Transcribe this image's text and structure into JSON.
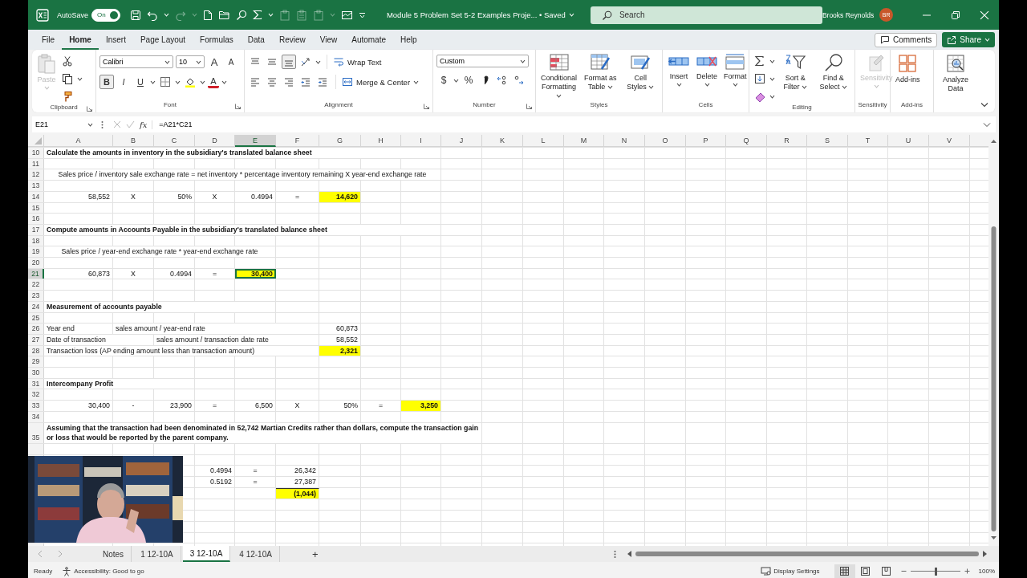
{
  "title_bar": {
    "autosave_label": "AutoSave",
    "autosave_toggle": {
      "label": "On",
      "on": true
    },
    "document_title": "Module 5 Problem Set 5-2 Examples Proje... • Saved",
    "search": {
      "placeholder": "Search"
    },
    "user_name": "Brooks Reynolds",
    "avatar_initials": "BR"
  },
  "menu_tabs": [
    {
      "label": "File",
      "selected": false
    },
    {
      "label": "Home",
      "selected": true
    },
    {
      "label": "Insert",
      "selected": false
    },
    {
      "label": "Page Layout",
      "selected": false
    },
    {
      "label": "Formulas",
      "selected": false
    },
    {
      "label": "Data",
      "selected": false
    },
    {
      "label": "Review",
      "selected": false
    },
    {
      "label": "View",
      "selected": false
    },
    {
      "label": "Automate",
      "selected": false
    },
    {
      "label": "Help",
      "selected": false
    }
  ],
  "comments_button": "Comments",
  "share_button": "Share",
  "ribbon": {
    "clipboard": {
      "paste": {
        "label": "Paste",
        "disabled": true
      },
      "group_label": "Clipboard"
    },
    "font": {
      "font_name": "Calibri",
      "font_size": "10",
      "grow_font": "A",
      "shrink_font": "A",
      "bold": {
        "label": "B",
        "on": true
      },
      "italic": {
        "label": "I",
        "on": false
      },
      "underline": {
        "label": "U",
        "on": false
      },
      "font_color": "A",
      "group_label": "Font"
    },
    "alignment": {
      "wrap_text": "Wrap Text",
      "merge_center": "Merge & Center",
      "group_label": "Alignment"
    },
    "number": {
      "format": "Custom",
      "currency": "$",
      "percent": "%",
      "group_label": "Number"
    },
    "styles": {
      "buttons": [
        "Conditional Formatting",
        "Format as Table",
        "Cell Styles"
      ],
      "group_label": "Styles"
    },
    "cells": {
      "buttons": [
        "Insert",
        "Delete",
        "Format"
      ],
      "group_label": "Cells"
    },
    "editing": {
      "buttons": [
        "Sort & Filter",
        "Find & Select"
      ],
      "group_label": "Editing"
    },
    "sensitivity": {
      "button": {
        "label": "Sensitivity",
        "disabled": true
      },
      "group_label": "Sensitivity"
    },
    "addins": {
      "button": "Add-ins",
      "group_label": "Add-ins"
    },
    "analyze": {
      "button": "Analyze Data"
    }
  },
  "formula_bar": {
    "name_box": "E21",
    "fx": "fx",
    "formula": "=A21*C21"
  },
  "sheet": {
    "columns": [
      {
        "label": "A",
        "selected": false
      },
      {
        "label": "B",
        "selected": false
      },
      {
        "label": "C",
        "selected": false
      },
      {
        "label": "D",
        "selected": false
      },
      {
        "label": "E",
        "selected": true
      },
      {
        "label": "F",
        "selected": false
      },
      {
        "label": "G",
        "selected": false
      },
      {
        "label": "H",
        "selected": false
      },
      {
        "label": "I",
        "selected": false
      },
      {
        "label": "J",
        "selected": false
      },
      {
        "label": "K",
        "selected": false
      },
      {
        "label": "L",
        "selected": false
      },
      {
        "label": "M",
        "selected": false
      },
      {
        "label": "N",
        "selected": false
      },
      {
        "label": "O",
        "selected": false
      },
      {
        "label": "P",
        "selected": false
      },
      {
        "label": "Q",
        "selected": false
      },
      {
        "label": "R",
        "selected": false
      },
      {
        "label": "S",
        "selected": false
      },
      {
        "label": "T",
        "selected": false
      },
      {
        "label": "U",
        "selected": false
      },
      {
        "label": "V",
        "selected": false
      }
    ],
    "rows": [
      {
        "number": "10",
        "selected": false,
        "cells": [
          {
            "kind": "heading",
            "text": "Calculate the amounts in inventory in the subsidiary's translated balance sheet",
            "selected": false
          },
          {
            "kind": "empty"
          },
          {
            "kind": "empty"
          },
          {
            "kind": "empty"
          },
          {
            "kind": "empty"
          },
          {
            "kind": "empty"
          },
          {
            "kind": "empty"
          },
          {
            "kind": "empty"
          },
          {
            "kind": "empty"
          }
        ]
      },
      {
        "number": "11",
        "selected": false
      },
      {
        "number": "12",
        "selected": false,
        "cells": [
          {
            "kind": "caption",
            "text": "Sales price / inventory sale exchange rate = net inventory * percentage inventory remaining X year-end exchange rate",
            "selected": false
          },
          {
            "kind": "empty"
          },
          {
            "kind": "empty"
          },
          {
            "kind": "empty"
          },
          {
            "kind": "empty"
          },
          {
            "kind": "empty"
          },
          {
            "kind": "empty"
          },
          {
            "kind": "empty"
          },
          {
            "kind": "empty"
          }
        ]
      },
      {
        "number": "13",
        "selected": false
      },
      {
        "number": "14",
        "selected": false,
        "cells": [
          {
            "kind": "number",
            "text": "58,552",
            "selected": false
          },
          {
            "kind": "operator",
            "text": "X",
            "selected": false
          },
          {
            "kind": "number",
            "text": "50%",
            "selected": false
          },
          {
            "kind": "operator",
            "text": "X",
            "selected": false
          },
          {
            "kind": "number",
            "text": "0.4994",
            "selected": false
          },
          {
            "kind": "operator",
            "text": "=",
            "selected": false
          },
          {
            "kind": "result",
            "text": "14,620",
            "selected": false
          }
        ]
      },
      {
        "number": "15",
        "selected": false
      },
      {
        "number": "16",
        "selected": false
      },
      {
        "number": "17",
        "selected": false,
        "cells": [
          {
            "kind": "heading",
            "text": "Compute amounts in Accounts Payable in the subsidiary's translated balance sheet",
            "selected": false
          },
          {
            "kind": "empty"
          },
          {
            "kind": "empty"
          },
          {
            "kind": "empty"
          },
          {
            "kind": "empty"
          },
          {
            "kind": "empty"
          },
          {
            "kind": "empty"
          },
          {
            "kind": "empty"
          },
          {
            "kind": "empty"
          }
        ]
      },
      {
        "number": "18",
        "selected": false
      },
      {
        "number": "19",
        "selected": false,
        "cells": [
          {
            "kind": "caption",
            "text": "Sales price / year-end exchange rate * year-end exchange rate",
            "selected": false
          },
          {
            "kind": "empty"
          },
          {
            "kind": "empty"
          },
          {
            "kind": "empty"
          },
          {
            "kind": "empty"
          }
        ]
      },
      {
        "number": "20",
        "selected": false
      },
      {
        "number": "21",
        "selected": true,
        "cells": [
          {
            "kind": "number",
            "text": "60,873",
            "selected": false
          },
          {
            "kind": "operator",
            "text": "X",
            "selected": false
          },
          {
            "kind": "number",
            "text": "0.4994",
            "selected": false
          },
          {
            "kind": "operator",
            "text": "=",
            "selected": false
          },
          {
            "kind": "result",
            "text": "30,400",
            "selected": true
          }
        ]
      },
      {
        "number": "22",
        "selected": false
      },
      {
        "number": "23",
        "selected": false
      },
      {
        "number": "24",
        "selected": false,
        "cells": [
          {
            "kind": "heading",
            "text": "Measurement of accounts payable",
            "selected": false
          },
          {
            "kind": "empty"
          },
          {
            "kind": "empty"
          },
          {
            "kind": "empty"
          },
          {
            "kind": "empty"
          }
        ]
      },
      {
        "number": "25",
        "selected": false
      },
      {
        "number": "26",
        "selected": false,
        "cells": [
          {
            "kind": "text",
            "text": "Year end",
            "selected": false
          },
          {
            "kind": "text",
            "text": "sales amount / year-end rate",
            "selected": false
          },
          {
            "kind": "empty"
          },
          {
            "kind": "empty"
          },
          {
            "kind": "empty"
          },
          {
            "kind": "empty"
          },
          {
            "kind": "number",
            "text": "60,873",
            "selected": false
          }
        ]
      },
      {
        "number": "27",
        "selected": false,
        "cells": [
          {
            "kind": "text",
            "text": "Date of transaction",
            "selected": false
          },
          {
            "kind": "empty"
          },
          {
            "kind": "text",
            "text": "sales amount / transaction date rate",
            "selected": false
          },
          {
            "kind": "empty"
          },
          {
            "kind": "empty"
          },
          {
            "kind": "empty"
          },
          {
            "kind": "number",
            "text": "58,552",
            "selected": false
          }
        ]
      },
      {
        "number": "28",
        "selected": false,
        "cells": [
          {
            "kind": "text",
            "text": "Transaction loss (AP ending amount less than transaction amount)",
            "selected": false
          },
          {
            "kind": "empty"
          },
          {
            "kind": "empty"
          },
          {
            "kind": "empty"
          },
          {
            "kind": "empty"
          },
          {
            "kind": "empty"
          },
          {
            "kind": "result",
            "text": "2,321",
            "selected": false
          }
        ]
      },
      {
        "number": "29",
        "selected": false
      },
      {
        "number": "30",
        "selected": false
      },
      {
        "number": "31",
        "selected": false,
        "cells": [
          {
            "kind": "heading",
            "text": "Intercompany Profit",
            "selected": false
          },
          {
            "kind": "empty"
          },
          {
            "kind": "empty"
          }
        ]
      },
      {
        "number": "32",
        "selected": false
      },
      {
        "number": "33",
        "selected": false,
        "cells": [
          {
            "kind": "number",
            "text": "30,400",
            "selected": false
          },
          {
            "kind": "operator",
            "text": "-",
            "selected": false
          },
          {
            "kind": "number",
            "text": "23,900",
            "selected": false
          },
          {
            "kind": "operator",
            "text": "=",
            "selected": false
          },
          {
            "kind": "number",
            "text": "6,500",
            "selected": false
          },
          {
            "kind": "operator",
            "text": "X",
            "selected": false
          },
          {
            "kind": "number",
            "text": "50%",
            "selected": false
          },
          {
            "kind": "operator",
            "text": "=",
            "selected": false
          },
          {
            "kind": "result",
            "text": "3,250",
            "selected": false
          }
        ]
      },
      {
        "number": "34",
        "selected": false
      },
      {
        "number": "35",
        "selected": false,
        "cells": [
          {
            "kind": "heading",
            "text": "Assuming that the transaction had been denominated in 52,742 Martian Credits rather than dollars, compute the transaction gain or loss that would be reported by the parent company.",
            "selected": false
          },
          {
            "kind": "empty"
          },
          {
            "kind": "empty"
          },
          {
            "kind": "empty"
          },
          {
            "kind": "empty"
          },
          {
            "kind": "empty"
          },
          {
            "kind": "empty"
          },
          {
            "kind": "empty"
          },
          {
            "kind": "empty"
          },
          {
            "kind": "empty"
          }
        ]
      },
      {
        "selected": false
      },
      {},
      {
        "cells": [
          {
            "kind": "empty"
          },
          {
            "kind": "empty"
          },
          {
            "kind": "empty"
          },
          {
            "kind": "number",
            "text": "0.4994",
            "selected": false
          },
          {
            "kind": "operator",
            "text": "=",
            "selected": false
          },
          {
            "kind": "number",
            "text": "26,342",
            "selected": false
          }
        ]
      },
      {
        "cells": [
          {
            "kind": "empty"
          },
          {
            "kind": "empty"
          },
          {
            "kind": "empty"
          },
          {
            "kind": "number",
            "text": "0.5192",
            "selected": false
          },
          {
            "kind": "operator",
            "text": "=",
            "selected": false
          },
          {
            "kind": "number",
            "text": "27,387",
            "selected": false
          }
        ]
      },
      {
        "cells": [
          {
            "kind": "empty"
          },
          {
            "kind": "empty"
          },
          {
            "kind": "empty"
          },
          {
            "kind": "empty"
          },
          {
            "kind": "empty"
          },
          {
            "kind": "total",
            "text": "(1,044)",
            "selected": false
          }
        ]
      }
    ]
  },
  "sheet_tabs": [
    {
      "label": "Notes",
      "selected": false
    },
    {
      "label": "1 12-10A",
      "selected": false
    },
    {
      "label": "3 12-10A",
      "selected": true
    },
    {
      "label": "4 12-10A",
      "selected": false
    }
  ],
  "add_sheet": "+",
  "status_bar": {
    "ready": "Ready",
    "accessibility": "Accessibility: Good to go",
    "display_settings": "Display Settings",
    "views": [
      {
        "selected": true
      },
      {
        "selected": false
      },
      {
        "selected": false
      }
    ],
    "zoom": {
      "level": 0.5,
      "reading": "100%"
    }
  }
}
